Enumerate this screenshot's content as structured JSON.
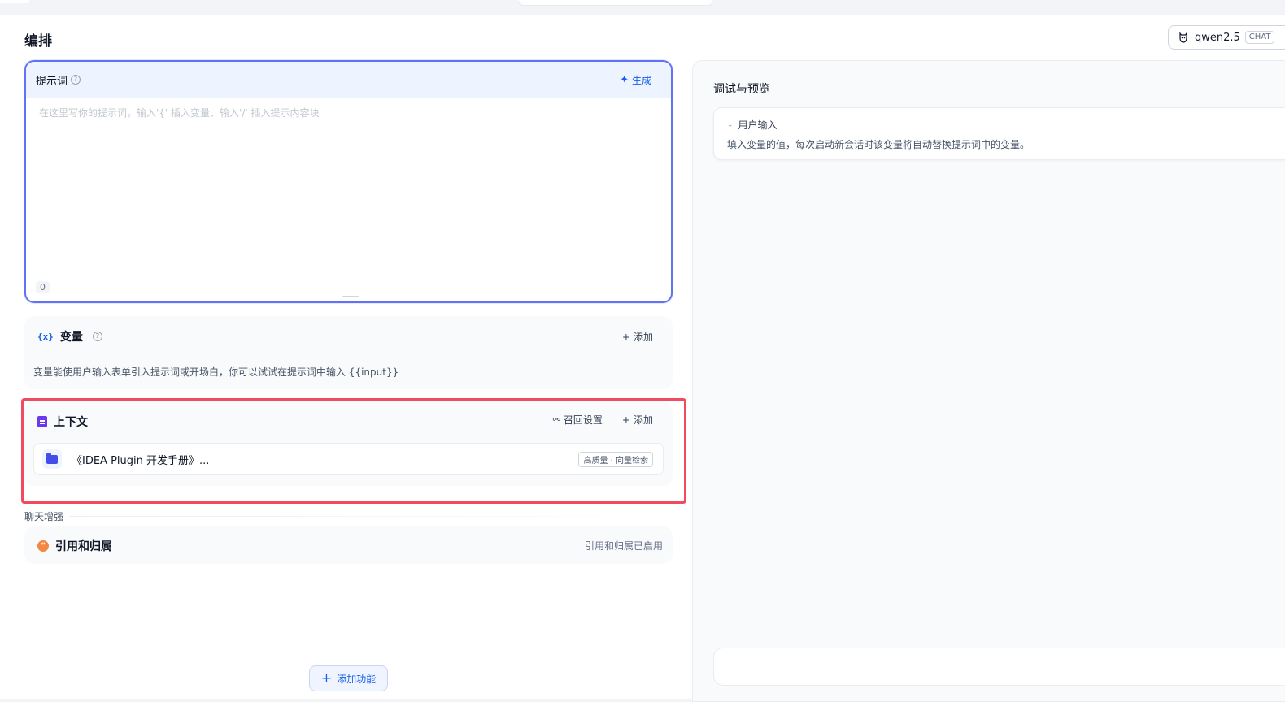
{
  "header": {
    "title": "编排"
  },
  "model": {
    "name": "qwen2.5",
    "mode_tag": "CHAT"
  },
  "prompt": {
    "label": "提示词",
    "generate_label": "生成",
    "placeholder": "在这里写你的提示词，输入'{' 插入变量、输入'/' 插入提示内容块",
    "char_count": "0"
  },
  "variables": {
    "title": "变量",
    "add_label": "添加",
    "description": "变量能使用户输入表单引入提示词或开场白，你可以试试在提示词中输入 {{input}}"
  },
  "context": {
    "title": "上下文",
    "recall_label": "召回设置",
    "add_label": "添加",
    "datasets": [
      {
        "name": "《IDEA Plugin 开发手册》...",
        "badge": "高质量 · 向量检索"
      }
    ]
  },
  "chat_enhance": {
    "section_label": "聊天增强",
    "citation_title": "引用和归属",
    "citation_status": "引用和归属已启用"
  },
  "add_feature_label": "添加功能",
  "debug": {
    "title": "调试与预览",
    "user_input_label": "用户输入",
    "user_input_desc": "填入变量的值，每次启动新会话时该变量将自动替换提示词中的变量。"
  },
  "colors": {
    "accent": "#155eef",
    "highlight_border": "#f04c5f",
    "prompt_border": "#6172f3"
  }
}
